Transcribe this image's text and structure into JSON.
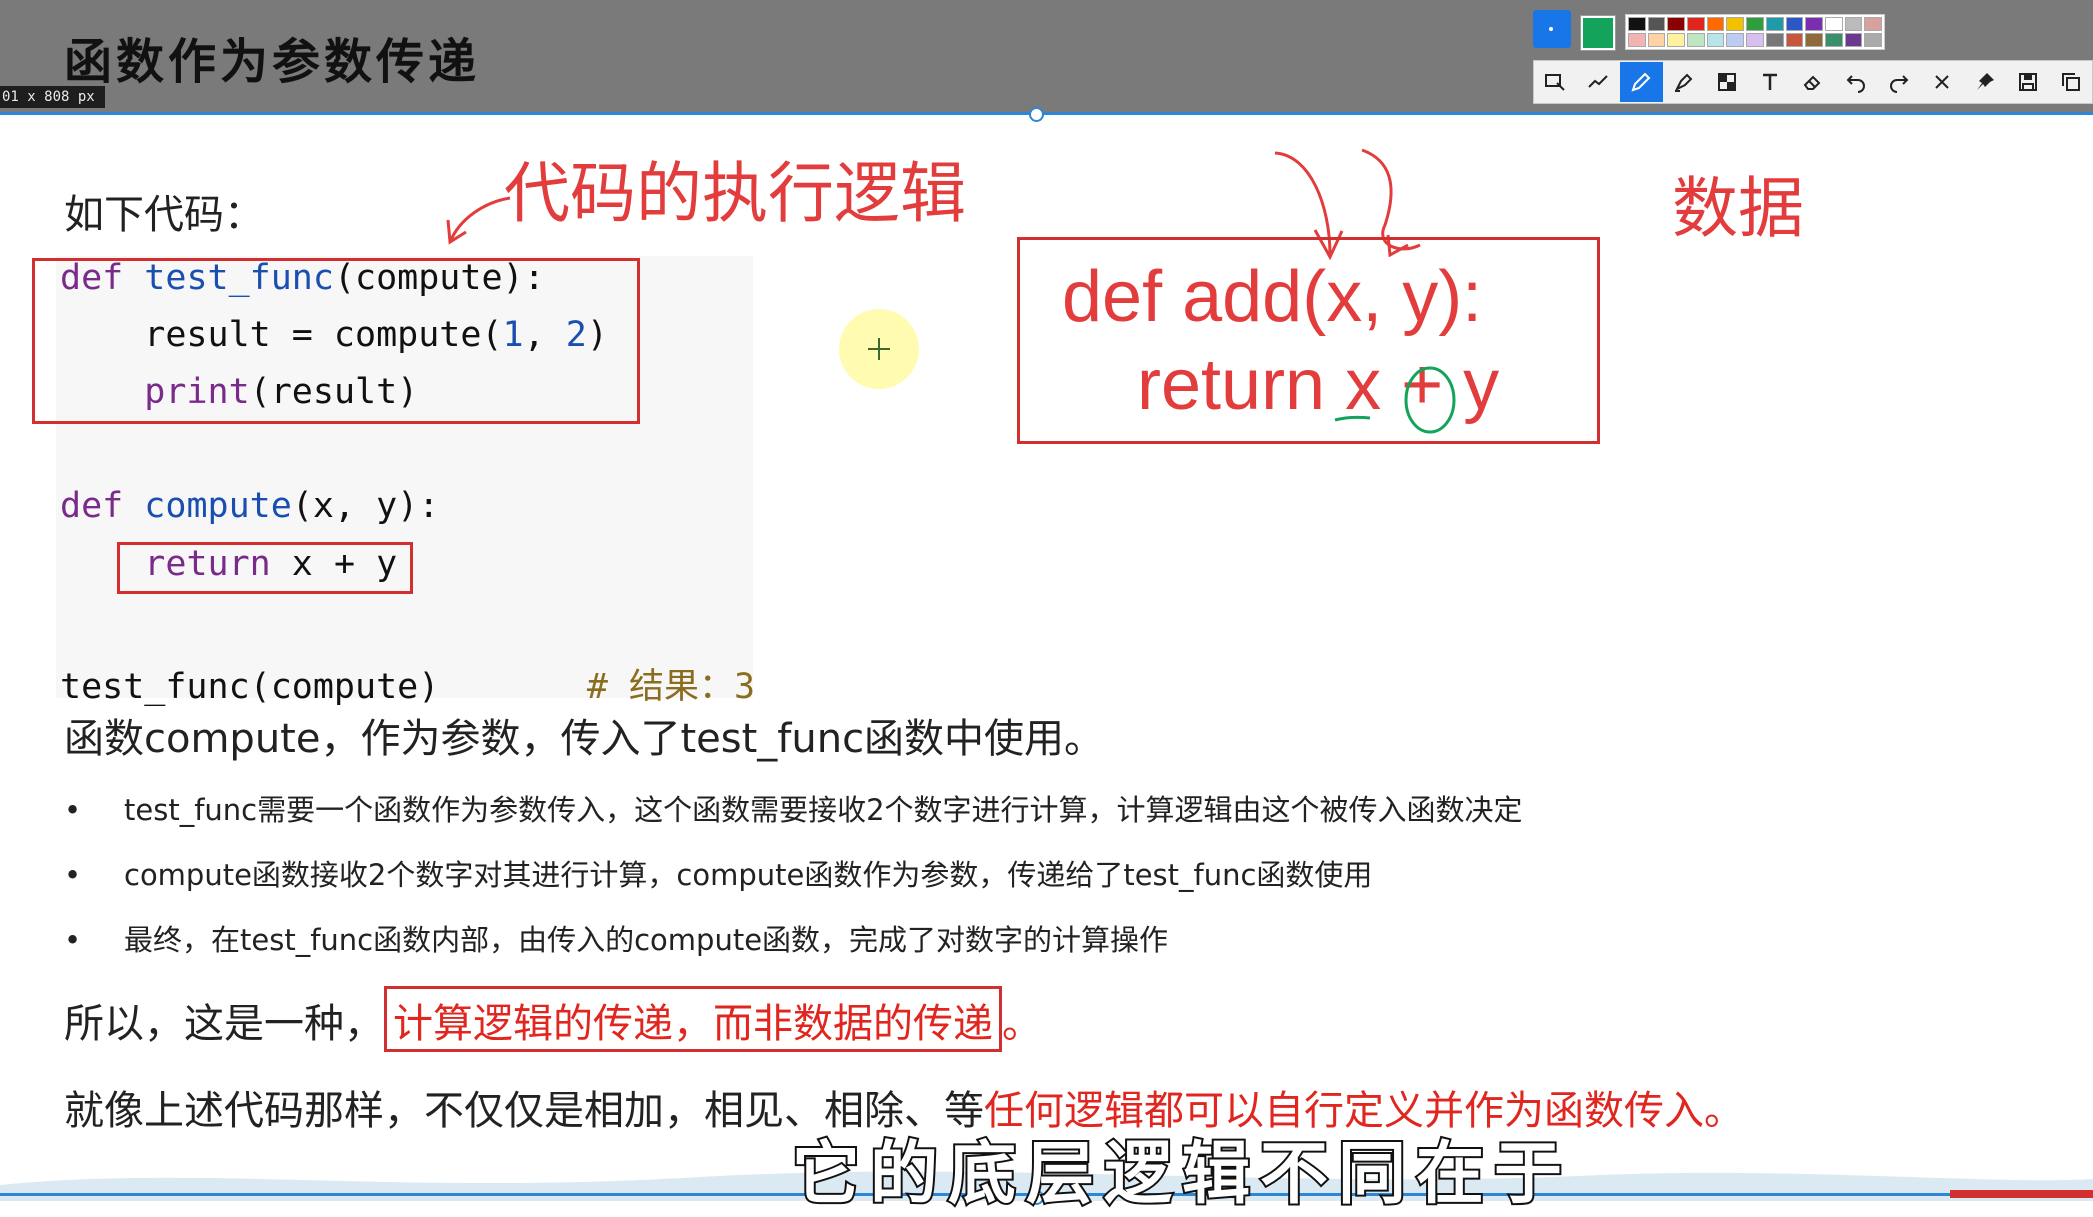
{
  "slide": {
    "title": "函数作为参数传递",
    "dimension_label": "01 x 808  px"
  },
  "annotation_toolbar": {
    "current_color": "#13a35a",
    "palette": [
      "#111111",
      "#555555",
      "#8b0000",
      "#e0261f",
      "#ff6a00",
      "#f2c200",
      "#2e9e3e",
      "#1f9aa8",
      "#2b57c7",
      "#7a2fb0",
      "#ffffff",
      "#bbbbbb",
      "#d9a0a0",
      "#f3b3b3",
      "#ffd2a6",
      "#fff1a0",
      "#bfe6c3",
      "#b6e4ea",
      "#bccbf2",
      "#d9bff0",
      "#777777",
      "#c8553d",
      "#8f6b3a",
      "#3a8f6b",
      "#6b3a8f",
      "#aaaaaa"
    ],
    "tools": [
      "select-icon",
      "line-icon",
      "pen-icon",
      "highlighter-icon",
      "mosaic-icon",
      "text-icon",
      "eraser-icon",
      "undo-icon",
      "redo-icon",
      "close-icon",
      "pin-icon",
      "save-icon",
      "copy-icon"
    ]
  },
  "content": {
    "intro": "如下代码：",
    "code": {
      "l1": {
        "kw": "def",
        "fn": "test_func",
        "rest": "(compute):"
      },
      "l2": {
        "a": "    result = compute(",
        "n1": "1",
        ",": ", ",
        "n2": "2",
        "end": ")"
      },
      "l3": {
        "indent": "    ",
        "kw": "print",
        "rest": "(result)"
      },
      "l4": {
        "kw": "def",
        "fn": "compute",
        "rest": "(x, y):"
      },
      "l5": {
        "indent": "    ",
        "kw": "return",
        "rest": " x + y"
      },
      "l6": {
        "call": "test_func(compute)",
        "comment": "# 结果：3"
      }
    },
    "annotation_logic": "代码的执行逻辑",
    "annotation_data": "数据",
    "add_code": {
      "line1": "def add(x, y):",
      "line2": "return x + y"
    },
    "explanation": "函数compute，作为参数，传入了test_func函数中使用。",
    "bullets": [
      "test_func需要一个函数作为参数传入，这个函数需要接收2个数字进行计算，计算逻辑由这个被传入函数决定",
      "compute函数接收2个数字对其进行计算，compute函数作为参数，传递给了test_func函数使用",
      "最终，在test_func函数内部，由传入的compute函数，完成了对数字的计算操作"
    ],
    "conclusion_prefix": "所以，这是一种，",
    "conclusion_highlight": "计算逻辑的传递，而非数据的传递",
    "conclusion_suffix": "。",
    "final_prefix": "就像上述代码那样，不仅仅是相加，相见、相除、等",
    "final_highlight": "任何逻辑都可以自行定义并作为函数传入。"
  },
  "subtitle": "它的底层逻辑不同在于"
}
